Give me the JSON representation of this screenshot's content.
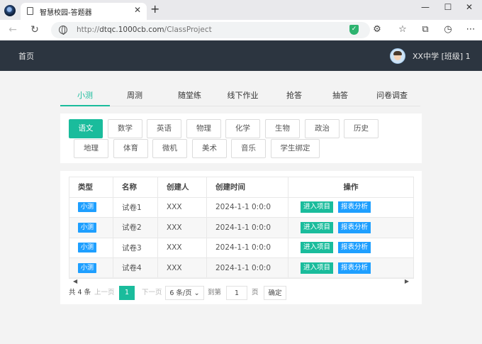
{
  "browser": {
    "tab_title": "智慧校园-答题器",
    "tab_close": "✕",
    "new_tab": "+",
    "url_prefix": "http://",
    "url_host": "dtqc.1000cb.com",
    "url_path": "/ClassProject",
    "icons": [
      "back-icon",
      "refresh-icon",
      "globe-icon",
      "shield-icon",
      "extensions-icon",
      "favorites-icon",
      "collections-icon",
      "history-icon",
      "more-icon"
    ]
  },
  "header": {
    "home": "首页",
    "user": "XX中学 [班级] 1"
  },
  "tabs": [
    "小测",
    "周测",
    "随堂练",
    "线下作业",
    "抢答",
    "抽答",
    "问卷调查"
  ],
  "active_tab": "小测",
  "subjects": [
    "语文",
    "数学",
    "英语",
    "物理",
    "化学",
    "生物",
    "政治",
    "历史",
    "地理",
    "体育",
    "微机",
    "美术",
    "音乐",
    "学生绑定"
  ],
  "active_subject": "语文",
  "table": {
    "headers": [
      "类型",
      "名称",
      "创建人",
      "创建时间",
      "操作"
    ],
    "rows": [
      {
        "type": "小测",
        "name": "试卷1",
        "creator": "XXX",
        "time": "2024-1-1 0:0:0",
        "enter": "进入项目",
        "report": "报表分析"
      },
      {
        "type": "小测",
        "name": "试卷2",
        "creator": "XXX",
        "time": "2024-1-1 0:0:0",
        "enter": "进入项目",
        "report": "报表分析"
      },
      {
        "type": "小测",
        "name": "试卷3",
        "creator": "XXX",
        "time": "2024-1-1 0:0:0",
        "enter": "进入项目",
        "report": "报表分析"
      },
      {
        "type": "小测",
        "name": "试卷4",
        "creator": "XXX",
        "time": "2024-1-1 0:0:0",
        "enter": "进入项目",
        "report": "报表分析"
      }
    ]
  },
  "pager": {
    "total": "共 4 条",
    "prev": "上一页",
    "current": "1",
    "next": "下一页",
    "page_size": "6 条/页",
    "goto": "到第",
    "goto_value": "1",
    "page_unit": "页",
    "confirm": "确定"
  },
  "colors": {
    "accent": "#1abc9c",
    "blue": "#1e9fff",
    "header": "#2c3540"
  }
}
